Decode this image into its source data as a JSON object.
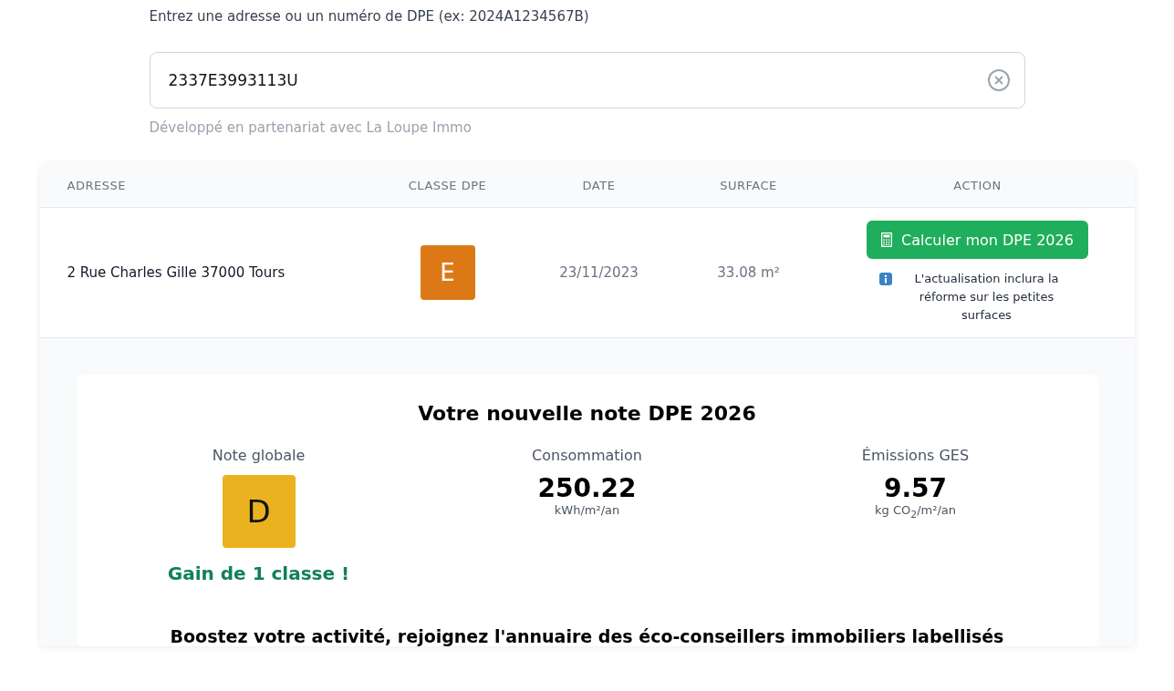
{
  "search": {
    "label": "Entrez une adresse ou un numéro de DPE (ex: 2024A1234567B)",
    "value": "2337E3993113U",
    "partner_note": "Développé en partenariat avec La Loupe Immo"
  },
  "table": {
    "columns": [
      "ADRESSE",
      "CLASSE DPE",
      "DATE",
      "SURFACE",
      "ACTION"
    ],
    "rows": [
      {
        "address": "2 Rue Charles Gille 37000 Tours",
        "dpe_class": {
          "letter": "E",
          "color": "#dc7916"
        },
        "date": "23/11/2023",
        "surface": "33.08 m²",
        "action_button": "Calculer mon DPE 2026",
        "action_note": "L'actualisation inclura la réforme sur les petites surfaces"
      }
    ]
  },
  "result": {
    "title": "Votre nouvelle note DPE 2026",
    "metrics": [
      {
        "kind": "grade",
        "label": "Note globale",
        "letter": "D",
        "color": "#eab21f",
        "gain": "Gain de 1 classe !"
      },
      {
        "kind": "value",
        "label": "Consommation",
        "value": "250.22",
        "unit": "kWh/m²/an"
      },
      {
        "kind": "value",
        "label": "Émissions GES",
        "value": "9.57",
        "unit": "kg CO$_{2}$/m²/an"
      }
    ],
    "promo": "Boostez votre activité, rejoignez l'annuaire des éco-conseillers immobiliers labellisés"
  }
}
